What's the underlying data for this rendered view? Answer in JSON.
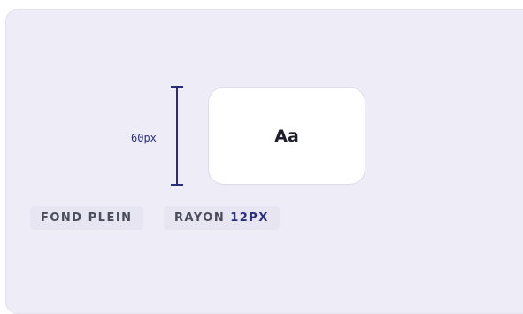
{
  "dimension": {
    "label": "60px"
  },
  "sample": {
    "text": "Aa"
  },
  "tags": {
    "fill_label": "FOND PLEIN",
    "radius_label": "RAYON",
    "radius_value": "12PX"
  },
  "colors": {
    "accent": "#2a2d7c",
    "panel_bg": "#eeedf7",
    "card_bg": "#ffffff",
    "tag_bg": "#e6e5f1",
    "tag_text": "#4b4c5c"
  }
}
